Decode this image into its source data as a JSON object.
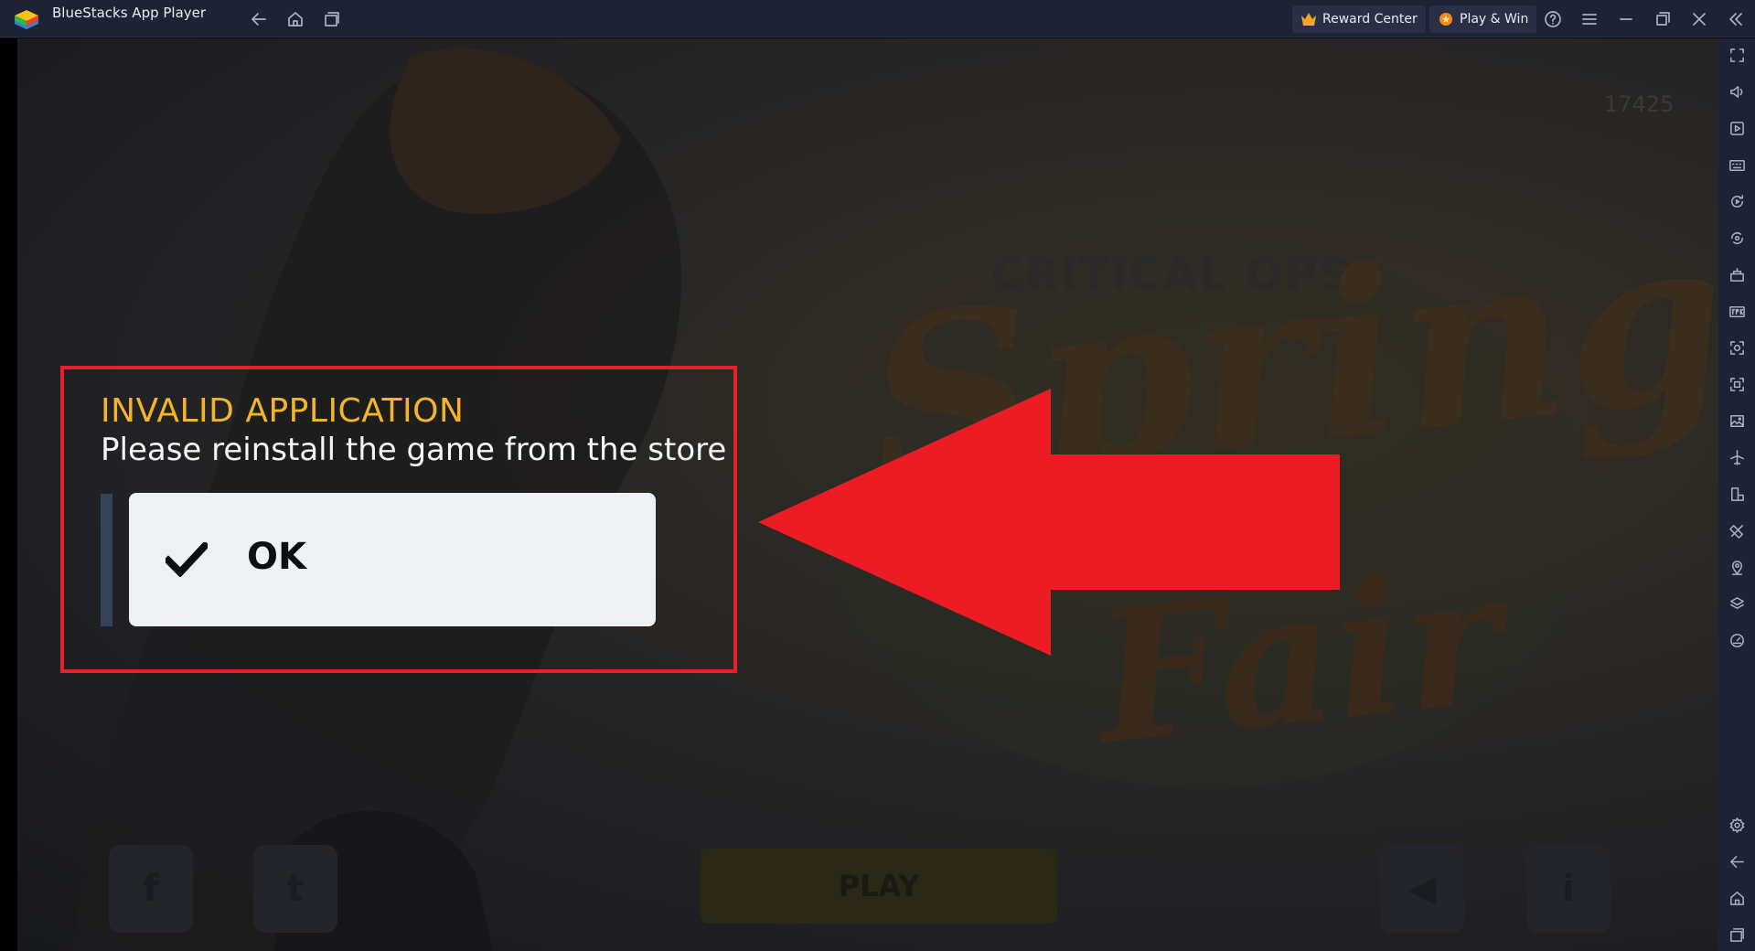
{
  "window": {
    "title": "BlueStacks App Player",
    "reward_center_label": "Reward Center",
    "play_win_label": "Play & Win"
  },
  "titlebar_icons": [
    "back-icon",
    "home-icon",
    "recent-apps-icon",
    "help-icon",
    "menu-icon",
    "minimize-icon",
    "restore-icon",
    "close-icon",
    "collapse-sidebar-icon"
  ],
  "sidebar_icons": [
    "fullscreen-icon",
    "volume-icon",
    "media-icon",
    "keyboard-icon",
    "rotate-icon",
    "sync-icon",
    "macro-icon",
    "apk-icon",
    "screenshot-icon",
    "record-icon",
    "gallery-icon",
    "airplane-icon",
    "multi-instance-icon",
    "eco-mode-icon",
    "location-icon",
    "layers-icon",
    "performance-icon",
    "settings-icon",
    "back-icon",
    "home-icon",
    "recent-apps-icon"
  ],
  "game": {
    "background_score": "17425",
    "background_subtitle": "CRITICAL OPS",
    "background_title_line1": "Spring",
    "background_title_line2": "Fair",
    "background_play_label": "PLAY"
  },
  "dialog": {
    "title": "INVALID APPLICATION",
    "message": "Please reinstall the game from the store",
    "ok_label": "OK"
  },
  "colors": {
    "titlebar_bg": "#1e2235",
    "dialog_title": "#f2b52a",
    "highlight_red": "#e5212b",
    "arrow_red": "#ed1c24",
    "ok_button_bg": "#eef1f4"
  }
}
